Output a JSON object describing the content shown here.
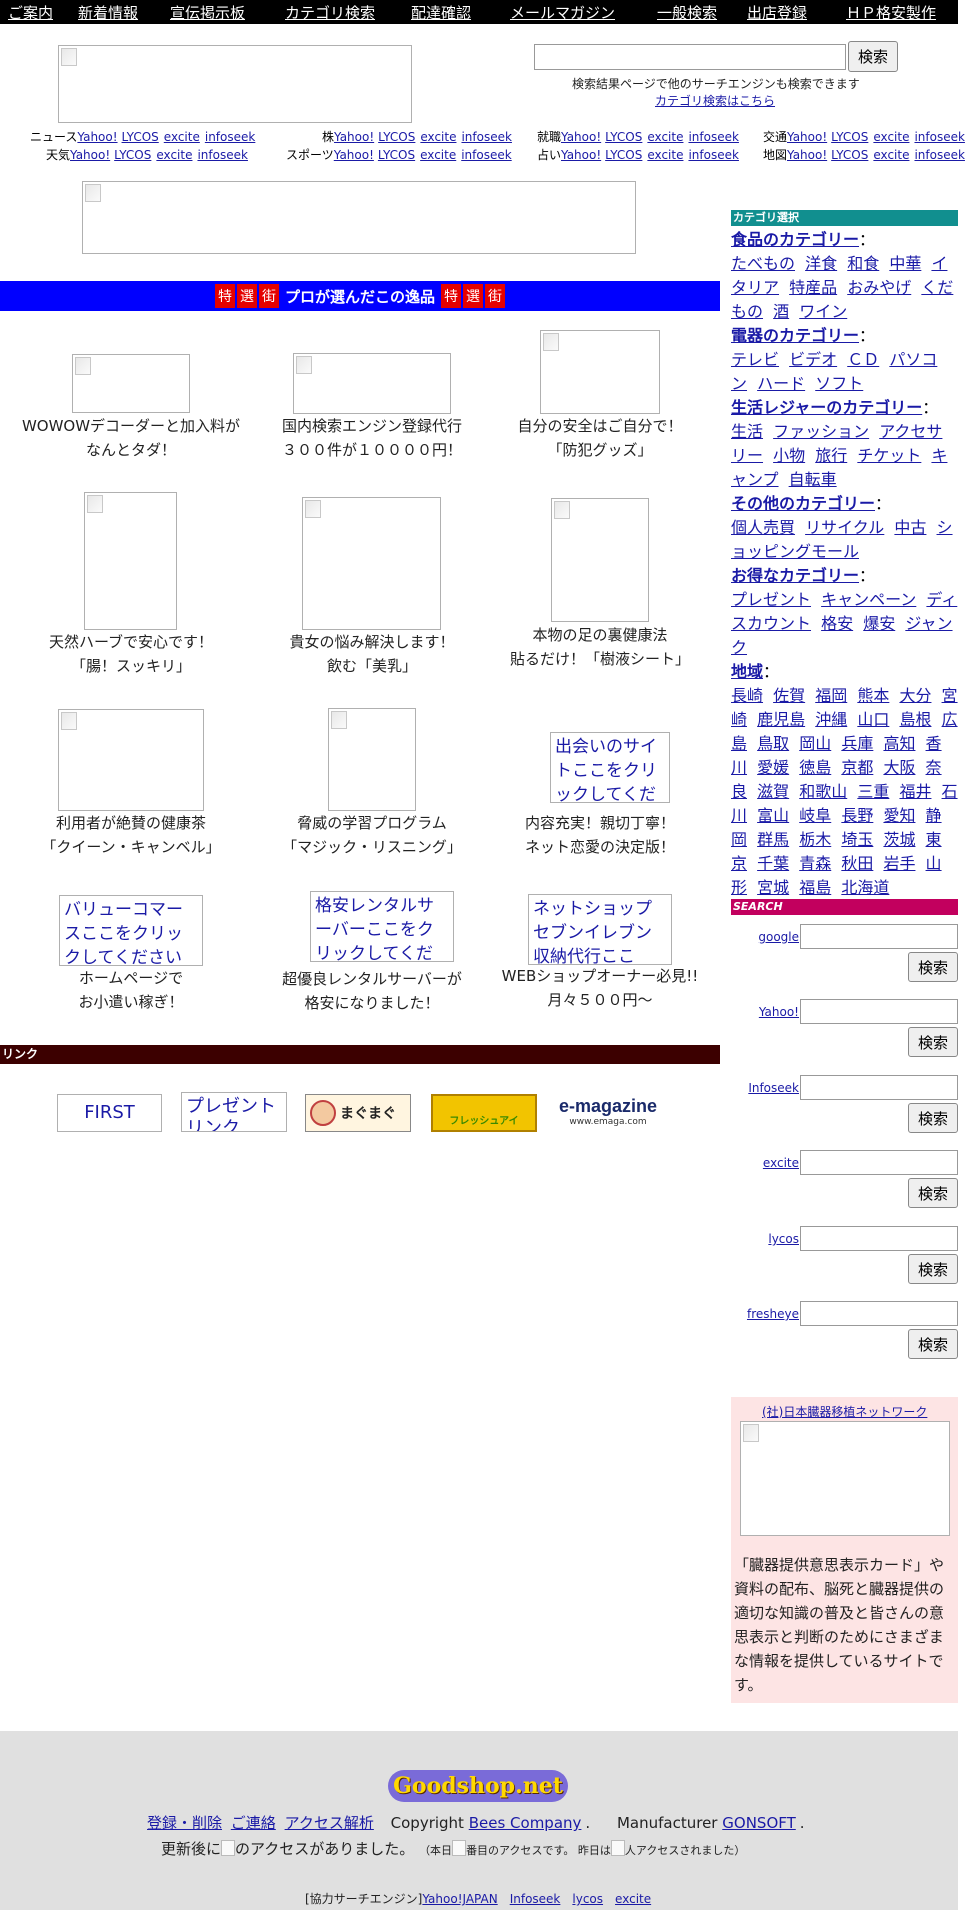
{
  "nav": [
    "ご案内",
    "新着情報",
    "宣伝掲示板",
    "カテゴリ検索",
    "配達確認",
    "メールマガジン",
    "一般検索",
    "出店登録",
    "ＨＰ格安製作"
  ],
  "top_search": {
    "button": "検索",
    "note": "検索結果ページで他のサーチエンジンも検索できます",
    "category_link": "カテゴリ検索はこちら"
  },
  "engine_links": {
    "engines": [
      "Yahoo!",
      "LYCOS",
      "excite",
      "infoseek"
    ],
    "labels": [
      "ニュース",
      "株",
      "就職",
      "交通",
      "天気",
      "スポーツ",
      "占い",
      "地図"
    ]
  },
  "feature": {
    "tags": [
      "特",
      "選",
      "街"
    ],
    "title": "プロが選んだこの逸品"
  },
  "products": [
    {
      "line1": "WOWOWデコーダーと加入料が",
      "line2": "なんとタダ！"
    },
    {
      "line1": "国内検索エンジン登録代行",
      "line2": "３００件が１００００円！"
    },
    {
      "line1": "自分の安全はご自分で！",
      "line2": "「防犯グッズ」"
    },
    {
      "line1": "天然ハーブで安心です！",
      "line2": "「腸！スッキリ」"
    },
    {
      "line1": "貴女の悩み解決します！",
      "line2": "飲む「美乳」"
    },
    {
      "line1": "本物の足の裏健康法",
      "line2": "貼るだけ！「樹液シート」"
    },
    {
      "line1": "利用者が絶賛の健康茶",
      "line2": "「クイーン・キャンベル」"
    },
    {
      "line1": "脅威の学習プログラム",
      "line2": "「マジック・リスニング」"
    },
    {
      "line1": "内容充実！親切丁寧！",
      "line2": "ネット恋愛の決定版！"
    },
    {
      "line1": "ホームページで",
      "line2": "お小遣い稼ぎ！"
    },
    {
      "line1": "超優良レンタルサーバーが",
      "line2": "格安になりました！"
    },
    {
      "line1": "WEBショップオーナー必見!!",
      "line2": "月々５００円〜"
    }
  ],
  "alt_texts": {
    "deai": "出会いのサイトここをクリックしてください",
    "value": "バリューコマースここをクリックしてください",
    "server": "格安レンタルサーバーここをクリックしてください",
    "netshop": "ネットショップセブンイレブン収納代行ここ"
  },
  "link_section": {
    "title": "リンク",
    "first": "FIRST",
    "present": "プレゼントリンク",
    "mag": "まぐまぐ",
    "fresh": "フレッシュアイ",
    "emag": "e-magazine",
    "emag_url": "www.emaga.com"
  },
  "sidebar": {
    "category_head": "カテゴリ選択",
    "categories": [
      {
        "title": "食品のカテゴリー",
        "items": [
          "たべもの",
          "洋食",
          "和食",
          "中華",
          "イタリア",
          "特産品",
          "おみやげ",
          "くだもの",
          "酒",
          "ワイン"
        ]
      },
      {
        "title": "電器のカテゴリー",
        "items": [
          "テレビ",
          "ビデオ",
          "ＣＤ",
          "パソコン",
          "ハード",
          "ソフト"
        ]
      },
      {
        "title": "生活レジャーのカテゴリー",
        "items": [
          "生活",
          "ファッション",
          "アクセサリー",
          "小物",
          "旅行",
          "チケット",
          "キャンプ",
          "自転車"
        ]
      },
      {
        "title": "その他のカテゴリー",
        "items": [
          "個人売買",
          "リサイクル",
          "中古",
          "ショッピングモール"
        ]
      },
      {
        "title": "お得なカテゴリー",
        "items": [
          "プレゼント",
          "キャンペーン",
          "ディスカウント",
          "格安",
          "爆安",
          "ジャンク"
        ]
      },
      {
        "title": "地域",
        "items": [
          "長崎",
          "佐賀",
          "福岡",
          "熊本",
          "大分",
          "宮崎",
          "鹿児島",
          "沖縄",
          "山口",
          "島根",
          "広島",
          "鳥取",
          "岡山",
          "兵庫",
          "高知",
          "香川",
          "愛媛",
          "徳島",
          "京都",
          "大阪",
          "奈良",
          "滋賀",
          "和歌山",
          "三重",
          "福井",
          "石川",
          "富山",
          "岐阜",
          "長野",
          "愛知",
          "静岡",
          "群馬",
          "栃木",
          "埼玉",
          "茨城",
          "東京",
          "千葉",
          "青森",
          "秋田",
          "岩手",
          "山形",
          "宮城",
          "福島",
          "北海道"
        ]
      }
    ],
    "colon": "：",
    "search_head": "SEARCH",
    "engines": [
      "google",
      "Yahoo!",
      "Infoseek",
      "excite",
      "lycos",
      "fresheye"
    ],
    "search_button": "検索",
    "organ_title": "(社)日本臓器移植ネットワーク",
    "organ_text": "「臓器提供意思表示カード」や資料の配布、脳死と臓器提供の適切な知識の普及と皆さんの意思表示と判断のためにさまざまな情報を提供しているサイトです。"
  },
  "footer": {
    "logo": "Goodshop.net",
    "links": [
      "登録・削除",
      "ご連絡",
      "アクセス解析"
    ],
    "copyright_pre": "Copyright",
    "company": "Bees Company",
    "manufacturer_pre": "Manufacturer",
    "manufacturer": "GONSOFT",
    "access_1": "更新後に",
    "access_2": "のアクセスがありました。",
    "today_1": "（本日",
    "today_2": "番目のアクセスです。 昨日は",
    "today_3": "人アクセスされました）",
    "engines_label": "[協力サーチエンジン]",
    "engines": [
      "Yahoo!JAPAN",
      "Infoseek",
      "lycos",
      "excite"
    ]
  }
}
